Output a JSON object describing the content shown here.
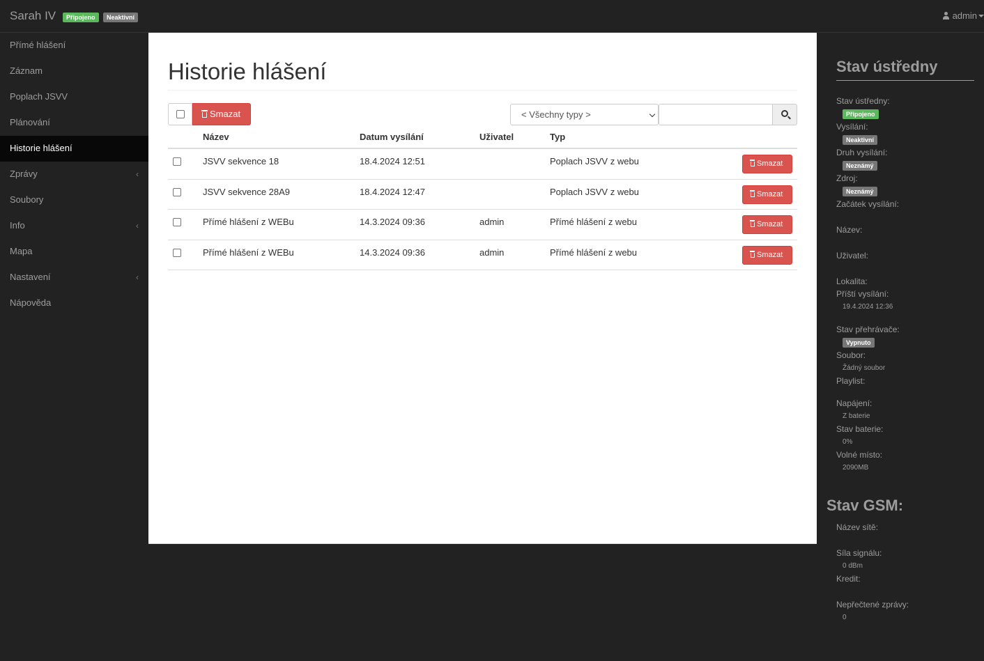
{
  "header": {
    "brand": "Sarah IV",
    "status_connected": "Připojeno",
    "status_broadcast": "Neaktivní",
    "user": "admin",
    "colors": {
      "green": "#5cb85c",
      "gray": "#777777",
      "danger": "#d9534f"
    }
  },
  "sidebar": {
    "items": [
      {
        "label": "Přímé hlášení",
        "has_submenu": false
      },
      {
        "label": "Záznam",
        "has_submenu": false
      },
      {
        "label": "Poplach JSVV",
        "has_submenu": false
      },
      {
        "label": "Plánování",
        "has_submenu": false
      },
      {
        "label": "Historie hlášení",
        "has_submenu": false,
        "active": true
      },
      {
        "label": "Zprávy",
        "has_submenu": true
      },
      {
        "label": "Soubory",
        "has_submenu": false
      },
      {
        "label": "Info",
        "has_submenu": true
      },
      {
        "label": "Mapa",
        "has_submenu": false
      },
      {
        "label": "Nastavení",
        "has_submenu": true
      },
      {
        "label": "Nápověda",
        "has_submenu": false
      }
    ],
    "submenu_arrow": "‹"
  },
  "main": {
    "title": "Historie hlášení",
    "toolbar": {
      "delete_label": "Smazat",
      "type_filter": "< Všechny typy >",
      "search_value": ""
    },
    "table": {
      "headers": {
        "name": "Název",
        "date": "Datum vysílání",
        "user": "Uživatel",
        "type": "Typ"
      },
      "rows": [
        {
          "name": "JSVV sekvence 18",
          "date": "18.4.2024 12:51",
          "user": "",
          "type": "Poplach JSVV z webu"
        },
        {
          "name": "JSVV sekvence 28A9",
          "date": "18.4.2024 12:47",
          "user": "",
          "type": "Poplach JSVV z webu"
        },
        {
          "name": "Přímé hlášení z WEBu",
          "date": "14.3.2024 09:36",
          "user": "admin",
          "type": "Přímé hlášení z webu"
        },
        {
          "name": "Přímé hlášení z WEBu",
          "date": "14.3.2024 09:36",
          "user": "admin",
          "type": "Přímé hlášení z webu"
        }
      ],
      "row_delete_label": "Smazat"
    }
  },
  "status_panel": {
    "title": "Stav ústředny",
    "central_state_label": "Stav ústředny:",
    "central_state": "Připojeno",
    "broadcast_label": "Vysílání:",
    "broadcast": "Neaktivní",
    "broadcast_kind_label": "Druh vysílání:",
    "broadcast_kind": "Neznámý",
    "source_label": "Zdroj:",
    "source": "Neznámý",
    "start_label": "Začátek vysílání:",
    "name_label": "Název:",
    "user_label": "Uživatel:",
    "locality_label": "Lokalita:",
    "next_label": "Příští vysílání:",
    "next_value": "19.4.2024 12:36",
    "player_label": "Stav přehrávače:",
    "player": "Vypnuto",
    "file_label": "Soubor:",
    "file_value": "Žádný soubor",
    "playlist_label": "Playlist:",
    "power_label": "Napájení:",
    "power_value": "Z baterie",
    "battery_label": "Stav baterie:",
    "battery_value": "0%",
    "space_label": "Volné místo:",
    "space_value": "2090MB"
  },
  "gsm": {
    "title": "Stav GSM:",
    "network_label": "Název sítě:",
    "signal_label": "Síla signálu:",
    "signal_value": "0 dBm",
    "credit_label": "Kredit:",
    "unread_label": "Nepřečtené zprávy:",
    "unread_value": "0"
  }
}
